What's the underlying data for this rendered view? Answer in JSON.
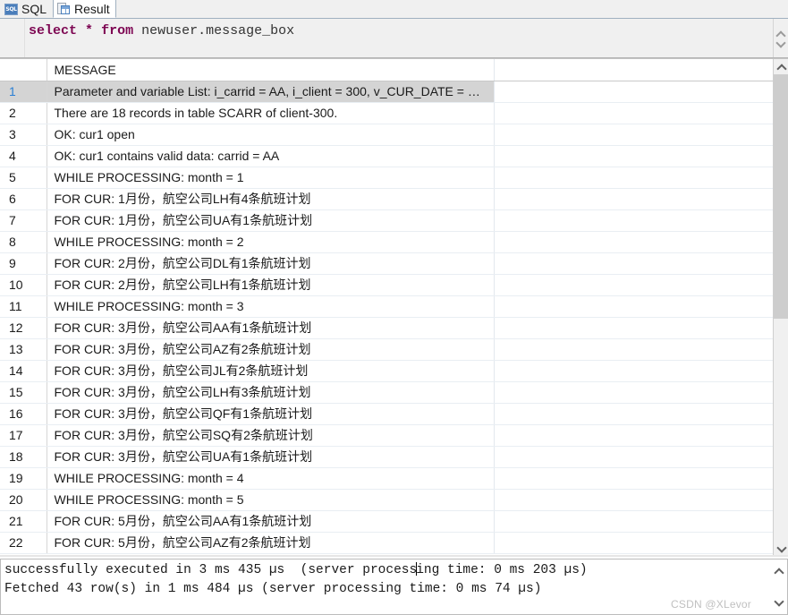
{
  "tabs": [
    {
      "label": "SQL",
      "icon": "sql-badge-icon",
      "active": false
    },
    {
      "label": "Result",
      "icon": "result-grid-icon",
      "active": true
    }
  ],
  "editor": {
    "statement_full": "select * from newuser.message_box",
    "tokens": {
      "kw_select": "select",
      "star": "*",
      "kw_from": "from",
      "table": "newuser.message_box"
    },
    "scroll_up_icon": "chevron-up-icon",
    "scroll_down_icon": "chevron-down-icon"
  },
  "grid": {
    "columns": [
      {
        "key": "rownum",
        "header": ""
      },
      {
        "key": "message",
        "header": "MESSAGE"
      },
      {
        "key": "filler",
        "header": ""
      }
    ],
    "selected_row": 1,
    "rows": [
      {
        "n": "1",
        "message": "Parameter and variable List: i_carrid = AA, i_client = 300, v_CUR_DATE = …"
      },
      {
        "n": "2",
        "message": "There are 18 records in table SCARR of client-300."
      },
      {
        "n": "3",
        "message": "OK: cur1 open"
      },
      {
        "n": "4",
        "message": "OK: cur1 contains valid data: carrid = AA"
      },
      {
        "n": "5",
        "message": "WHILE PROCESSING: month = 1"
      },
      {
        "n": "6",
        "message": "FOR CUR: 1月份，航空公司LH有4条航班计划"
      },
      {
        "n": "7",
        "message": "FOR CUR: 1月份，航空公司UA有1条航班计划"
      },
      {
        "n": "8",
        "message": "WHILE PROCESSING: month = 2"
      },
      {
        "n": "9",
        "message": "FOR CUR: 2月份，航空公司DL有1条航班计划"
      },
      {
        "n": "10",
        "message": "FOR CUR: 2月份，航空公司LH有1条航班计划"
      },
      {
        "n": "11",
        "message": "WHILE PROCESSING: month = 3"
      },
      {
        "n": "12",
        "message": "FOR CUR: 3月份，航空公司AA有1条航班计划"
      },
      {
        "n": "13",
        "message": "FOR CUR: 3月份，航空公司AZ有2条航班计划"
      },
      {
        "n": "14",
        "message": "FOR CUR: 3月份，航空公司JL有2条航班计划"
      },
      {
        "n": "15",
        "message": "FOR CUR: 3月份，航空公司LH有3条航班计划"
      },
      {
        "n": "16",
        "message": "FOR CUR: 3月份，航空公司QF有1条航班计划"
      },
      {
        "n": "17",
        "message": "FOR CUR: 3月份，航空公司SQ有2条航班计划"
      },
      {
        "n": "18",
        "message": "FOR CUR: 3月份，航空公司UA有1条航班计划"
      },
      {
        "n": "19",
        "message": "WHILE PROCESSING: month = 4"
      },
      {
        "n": "20",
        "message": "WHILE PROCESSING: month = 5"
      },
      {
        "n": "21",
        "message": "FOR CUR: 5月份，航空公司AA有1条航班计划"
      },
      {
        "n": "22",
        "message": "FOR CUR: 5月份，航空公司AZ有2条航班计划"
      }
    ],
    "scroll_up_icon": "scroll-arrow-up-icon",
    "scroll_down_icon": "scroll-arrow-down-icon"
  },
  "output": {
    "line1_a": "successfully executed in 3 ms 435 µs  (server process",
    "line1_b": "ing time: 0 ms 203 µs)",
    "line2": "Fetched 43 row(s) in 1 ms 484 µs (server processing time: 0 ms 74 µs)",
    "scroll_up_icon": "scroll-arrow-up-icon",
    "scroll_down_icon": "scroll-arrow-down-icon"
  },
  "watermark": {
    "text": "CSDN @XLevor"
  },
  "colors": {
    "keyword": "#7d0552",
    "selected_row_bg": "#d4d4d4",
    "selected_rownum_fg": "#2a7fd4",
    "tab_border": "#a0b0c0",
    "grid_line": "#e9eef3",
    "scroll_thumb": "#cdcdcd",
    "watermark": "#c0c0c0"
  }
}
